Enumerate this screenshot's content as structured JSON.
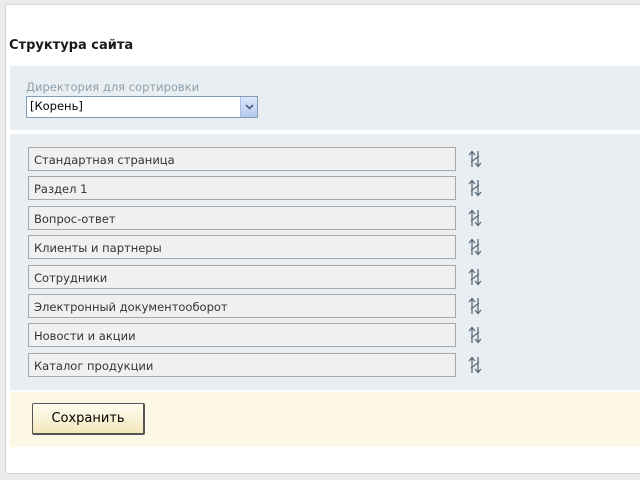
{
  "page": {
    "title": "Структура сайта"
  },
  "directory": {
    "label": "Директория для сортировки",
    "selected": "[Корень]",
    "dropdown_icon": "chevron-down-icon"
  },
  "items": [
    {
      "label": "Стандартная страница"
    },
    {
      "label": "Раздел 1"
    },
    {
      "label": "Вопрос-ответ"
    },
    {
      "label": "Клиенты и партнеры"
    },
    {
      "label": "Сотрудники"
    },
    {
      "label": "Электронный документооборот"
    },
    {
      "label": "Новости и акции"
    },
    {
      "label": "Каталог продукции"
    }
  ],
  "drag_icon": "reorder-arrows-icon",
  "actions": {
    "save_label": "Сохранить"
  },
  "colors": {
    "panel_bg": "#e8eef2",
    "save_panel_bg": "#fdf8e6",
    "label_color": "#8fa0ac"
  }
}
